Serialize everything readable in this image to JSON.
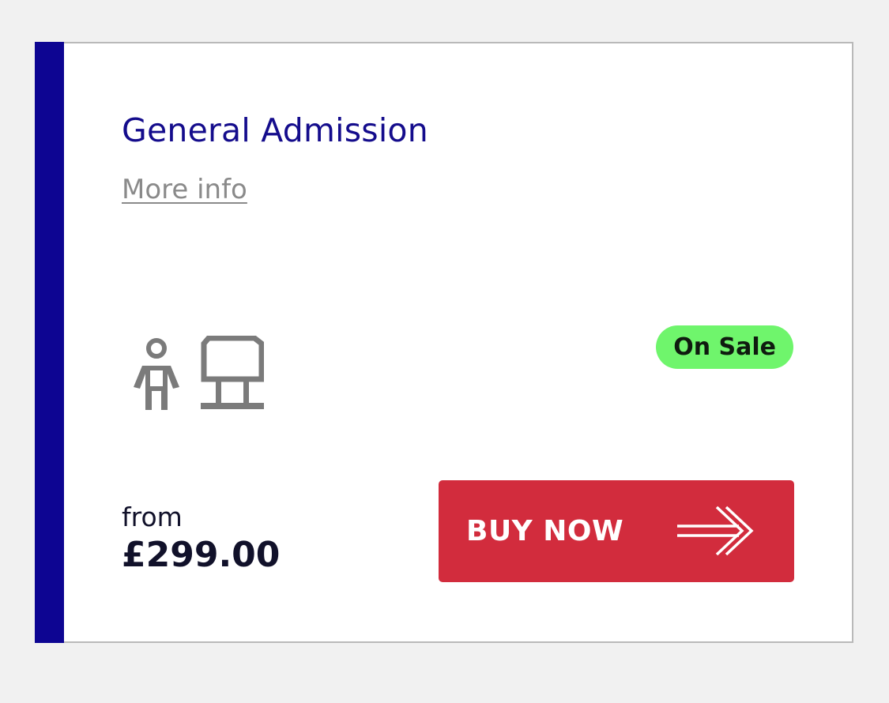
{
  "ticket": {
    "title": "General Admission",
    "more_info_label": "More info",
    "icons": [
      "person-icon",
      "seat-icon"
    ],
    "status": "On Sale",
    "price_prefix": "from",
    "price": "£299.00",
    "buy_label": "BUY NOW",
    "buy_icon": "arrow-right-icon"
  },
  "colors": {
    "accent": "#0d0592",
    "title": "#140c8c",
    "status_bg": "#6ff56c",
    "buy_bg": "#d22c3d",
    "icon": "#7b7b7b",
    "page_bg": "#f1f1f1"
  }
}
